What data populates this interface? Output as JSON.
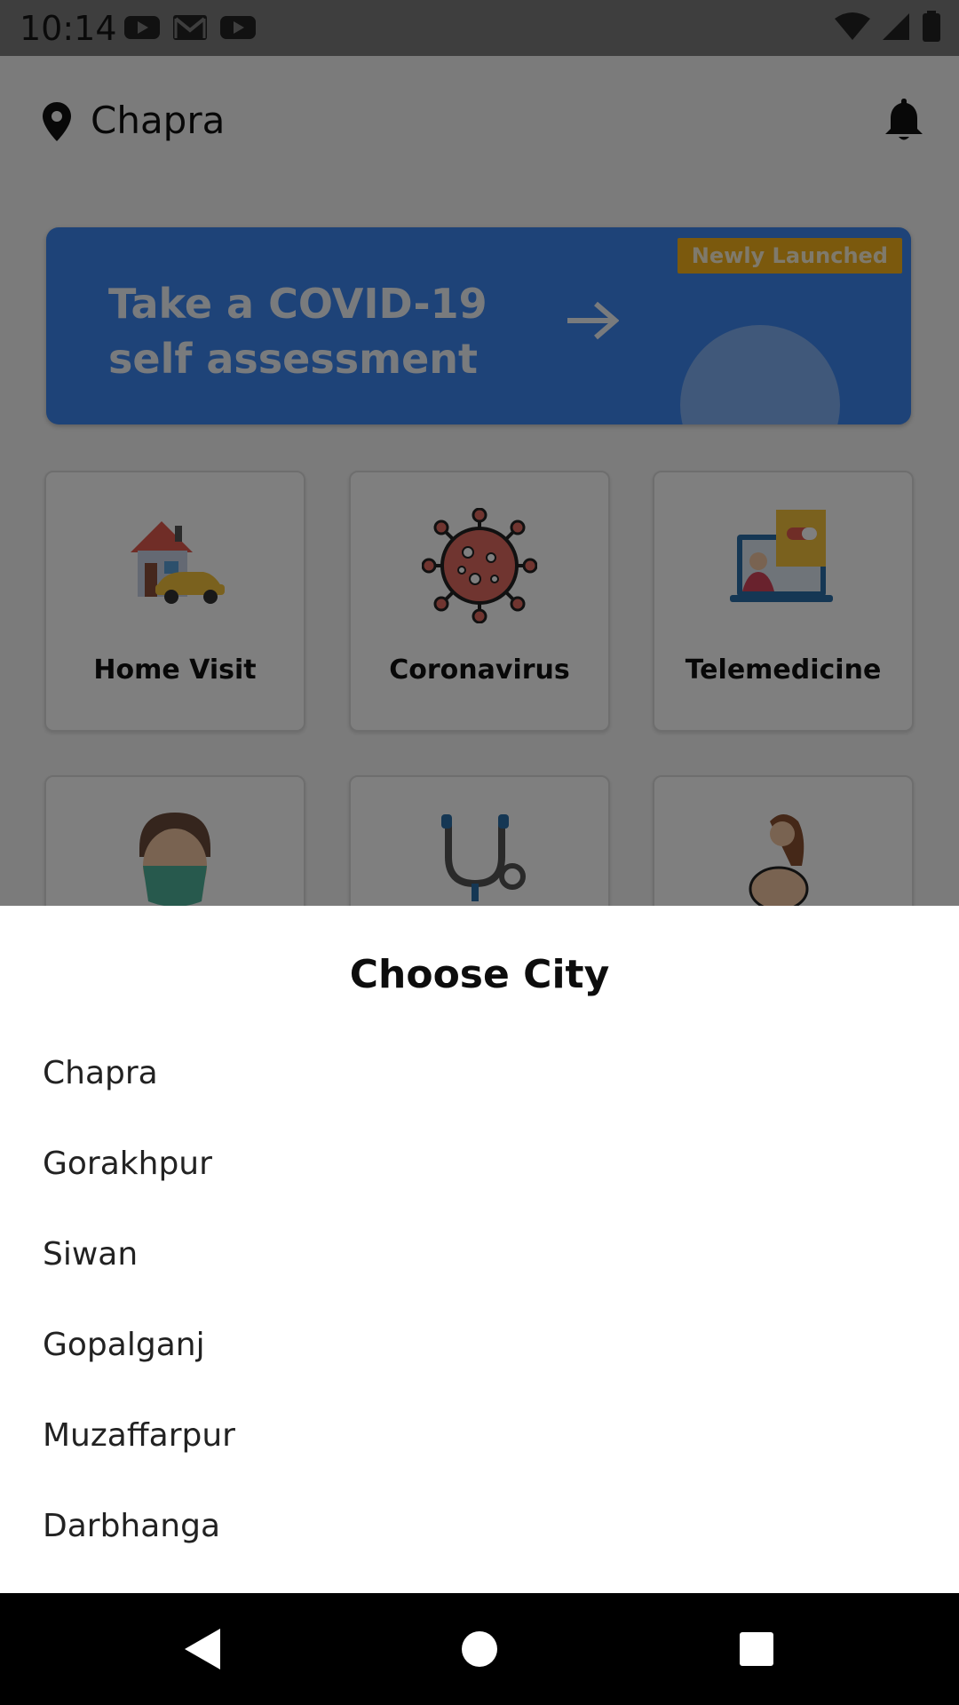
{
  "status_bar": {
    "time": "10:14",
    "notification_icons": [
      "youtube-icon",
      "gmail-icon",
      "youtube-icon"
    ],
    "system_icons": [
      "wifi-icon",
      "signal-icon",
      "battery-icon"
    ]
  },
  "header": {
    "location": "Chapra",
    "location_icon": "location-pin-icon",
    "notification_icon": "bell-icon"
  },
  "banner": {
    "text": "Take a COVID-19 self assessment",
    "badge": "Newly Launched",
    "color": "#3d86f0",
    "badge_color": "#f6b21a"
  },
  "services": [
    {
      "label": "Home Visit",
      "icon": "home-visit-icon"
    },
    {
      "label": "Coronavirus",
      "icon": "coronavirus-icon"
    },
    {
      "label": "Telemedicine",
      "icon": "telemedicine-icon"
    }
  ],
  "services_row2_icons": [
    "masked-person-icon",
    "stethoscope-icon",
    "pregnant-woman-icon"
  ],
  "city_sheet": {
    "title": "Choose City",
    "cities": [
      "Chapra",
      "Gorakhpur",
      "Siwan",
      "Gopalganj",
      "Muzaffarpur",
      "Darbhanga"
    ]
  },
  "nav_bar": {
    "buttons": [
      "back-icon",
      "home-icon",
      "recents-icon"
    ]
  }
}
